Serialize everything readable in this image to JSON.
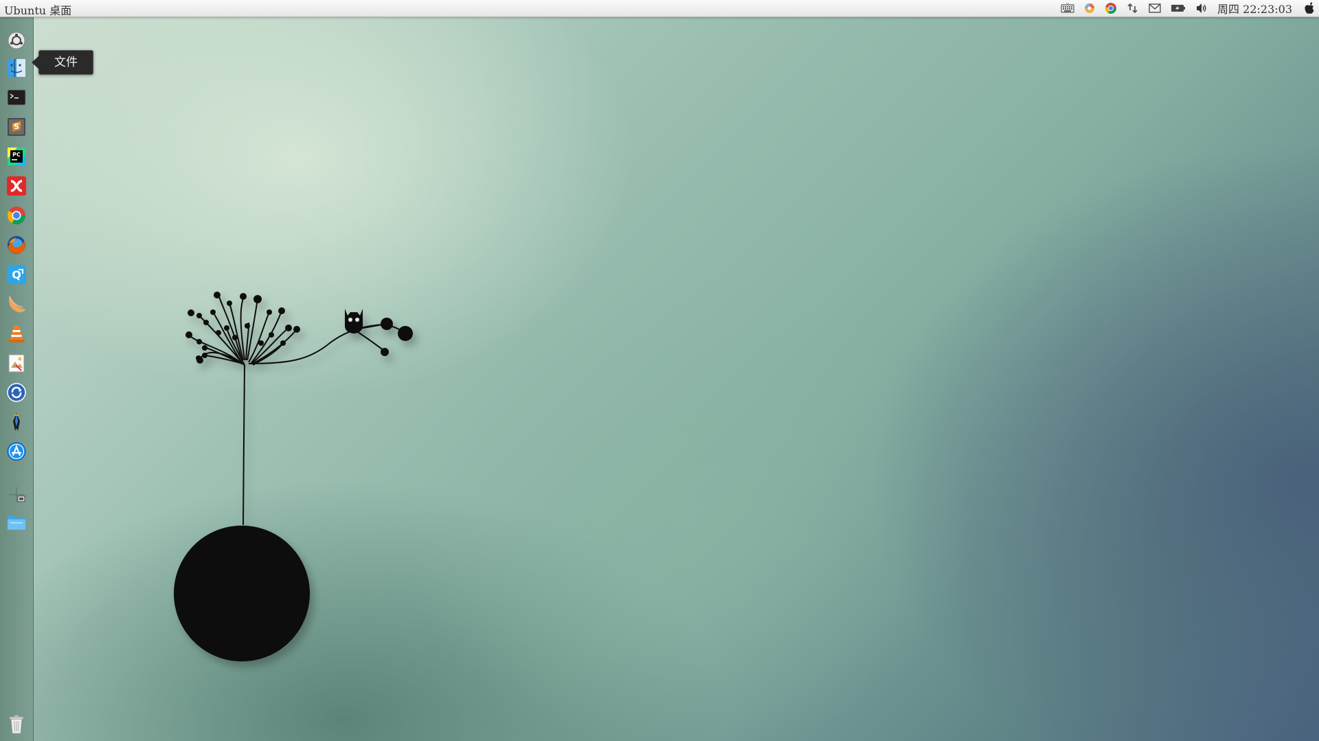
{
  "panel": {
    "title": "Ubuntu 桌面",
    "clock": "周四 22:23:03",
    "tray_icons": [
      "keyboard-icon",
      "color-picker-icon",
      "chrome-icon",
      "network-icon",
      "mail-icon",
      "battery-icon",
      "volume-icon",
      "apple-icon"
    ]
  },
  "launcher": {
    "tooltip": "文件",
    "items": [
      {
        "name": "dash-home"
      },
      {
        "name": "files"
      },
      {
        "name": "terminal"
      },
      {
        "name": "sublime-text"
      },
      {
        "name": "pycharm"
      },
      {
        "name": "xmind"
      },
      {
        "name": "chrome"
      },
      {
        "name": "firefox"
      },
      {
        "name": "qq"
      },
      {
        "name": "peach-app"
      },
      {
        "name": "vlc"
      },
      {
        "name": "image-viewer"
      },
      {
        "name": "software-updater"
      },
      {
        "name": "pen-tool"
      },
      {
        "name": "app-store"
      },
      {
        "name": "workspace-switcher"
      },
      {
        "name": "folder"
      },
      {
        "name": "trash"
      }
    ]
  },
  "colors": {
    "panel_bg": "#f0f0f0",
    "launcher_bg": "#72958a",
    "tooltip_bg": "#2a2a2a"
  }
}
